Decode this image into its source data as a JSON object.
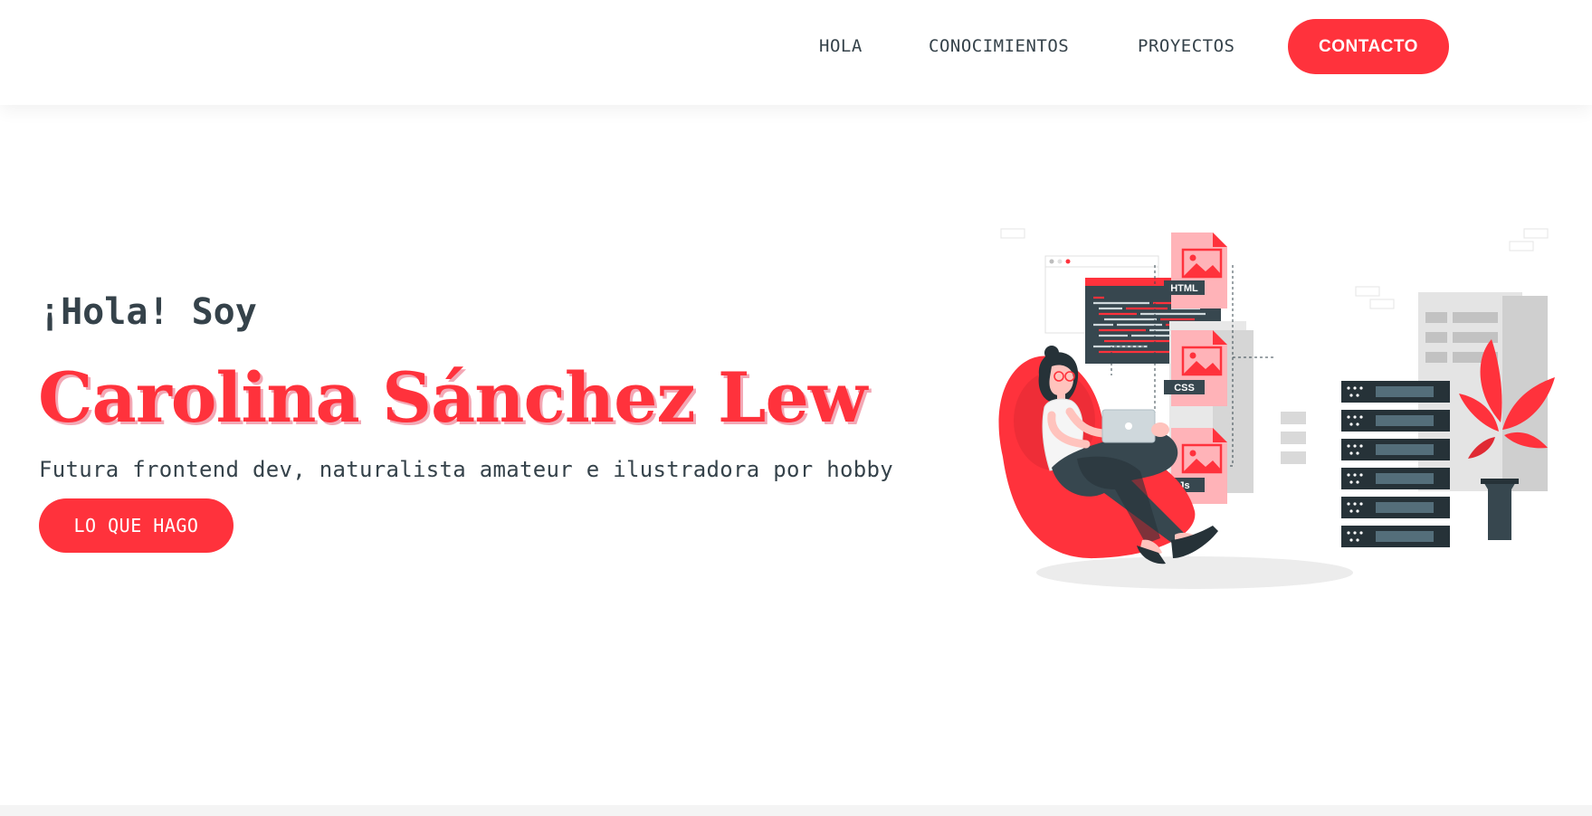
{
  "nav": {
    "links": [
      "HOLA",
      "CONOCIMIENTOS",
      "PROYECTOS"
    ],
    "cta": "CONTACTO"
  },
  "hero": {
    "greeting": "¡Hola! Soy",
    "name": "Carolina Sánchez Lew",
    "subtitle": "Futura frontend dev, naturalista amateur e ilustradora por hobby",
    "cta": "LO QUE HAGO"
  },
  "illustration": {
    "file_labels": [
      "HTML",
      "CSS",
      "Js"
    ]
  },
  "colors": {
    "accent": "#ff323c",
    "text": "#35424a",
    "name_shadow": "#f3a8b5",
    "dark": "#37474f",
    "light_red": "#ffb3b8"
  }
}
